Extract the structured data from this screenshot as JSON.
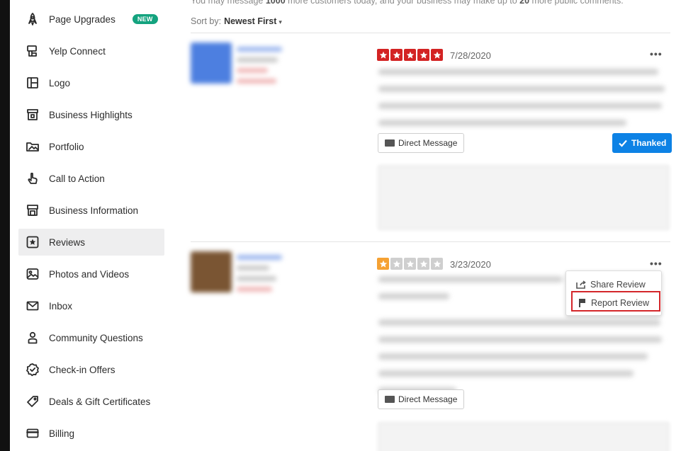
{
  "sidebar": {
    "items": [
      {
        "label": "Page Upgrades",
        "icon": "rocket-icon",
        "badge": "NEW",
        "active": false
      },
      {
        "label": "Yelp Connect",
        "icon": "megaphone-icon",
        "active": false
      },
      {
        "label": "Logo",
        "icon": "logo-icon",
        "active": false
      },
      {
        "label": "Business Highlights",
        "icon": "highlights-icon",
        "active": false
      },
      {
        "label": "Portfolio",
        "icon": "portfolio-icon",
        "active": false
      },
      {
        "label": "Call to Action",
        "icon": "tap-icon",
        "active": false
      },
      {
        "label": "Business Information",
        "icon": "storefront-icon",
        "active": false
      },
      {
        "label": "Reviews",
        "icon": "star-box-icon",
        "active": true
      },
      {
        "label": "Photos and Videos",
        "icon": "photo-icon",
        "active": false
      },
      {
        "label": "Inbox",
        "icon": "envelope-icon",
        "active": false
      },
      {
        "label": "Community Questions",
        "icon": "people-icon",
        "active": false
      },
      {
        "label": "Check-in Offers",
        "icon": "check-badge-icon",
        "active": false
      },
      {
        "label": "Deals & Gift Certificates",
        "icon": "tag-icon",
        "active": false
      },
      {
        "label": "Billing",
        "icon": "credit-card-icon",
        "active": false
      }
    ]
  },
  "main": {
    "top_note": {
      "prefix": "You may message ",
      "count_customers": "1000",
      "middle": " more customers today, and your business may make up to ",
      "count_comments": "20",
      "suffix": " more public comments."
    },
    "sort": {
      "label": "Sort by:",
      "value": "Newest First"
    },
    "reviews": [
      {
        "rating": 5,
        "date": "7/28/2020",
        "menu": "•••",
        "direct_message_label": "Direct Message",
        "thanked_label": "Thanked"
      },
      {
        "rating": 1,
        "date": "3/23/2020",
        "menu": "•••",
        "direct_message_label": "Direct Message"
      }
    ],
    "menu": {
      "share_label": "Share Review",
      "report_label": "Report Review"
    }
  },
  "colors": {
    "star_red": "#d32323",
    "star_orange": "#f5a133",
    "star_grey": "#cfcfcf",
    "thanked_blue": "#0d82e5",
    "new_badge_green": "#14a37f",
    "highlight_red": "#d4262a"
  }
}
